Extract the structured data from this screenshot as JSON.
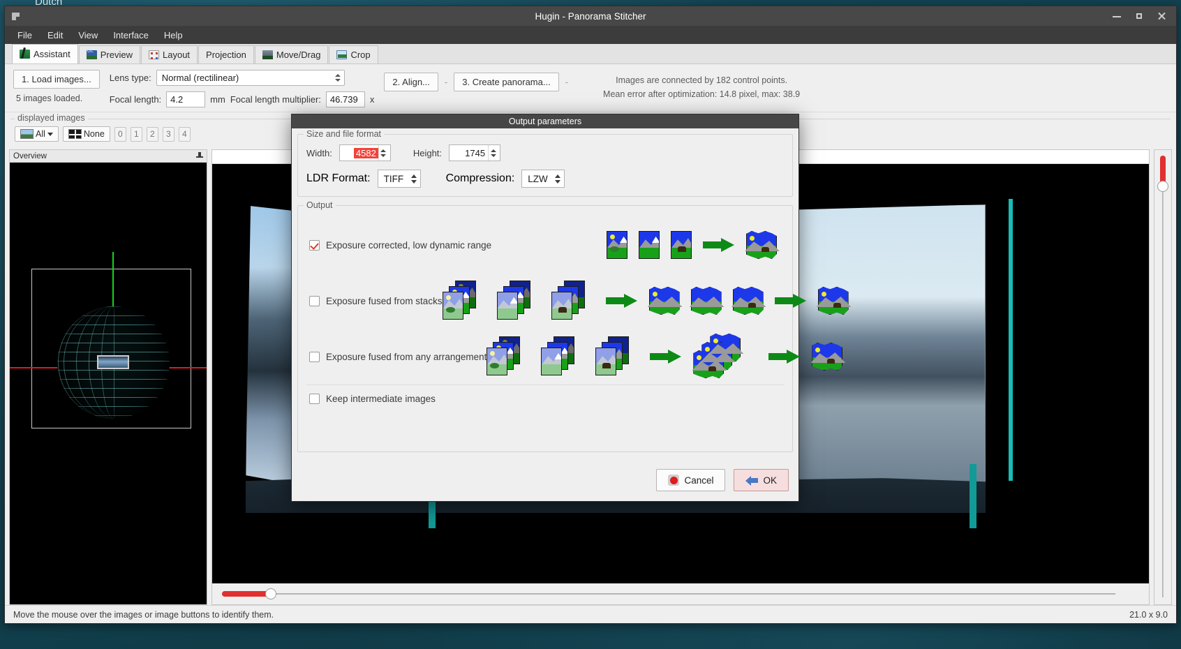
{
  "desktop": {
    "background_text": "Dutch"
  },
  "window": {
    "title": "Hugin - Panorama Stitcher",
    "controls": {
      "minimize": "minimize-button",
      "maximize": "maximize-button",
      "close": "close-button"
    }
  },
  "menubar": {
    "items": [
      "File",
      "Edit",
      "View",
      "Interface",
      "Help"
    ]
  },
  "tabs": [
    {
      "label": "Assistant",
      "icon": "assistant-icon",
      "active": true
    },
    {
      "label": "Preview",
      "icon": "gl-preview-icon",
      "active": false
    },
    {
      "label": "Layout",
      "icon": "layout-icon",
      "active": false
    },
    {
      "label": "Projection",
      "icon": "",
      "active": false
    },
    {
      "label": "Move/Drag",
      "icon": "move-drag-icon",
      "active": false
    },
    {
      "label": "Crop",
      "icon": "crop-icon",
      "active": false
    }
  ],
  "assistant": {
    "load_images_button": "1. Load images...",
    "images_loaded_text": "5 images loaded.",
    "lens_type_label": "Lens type:",
    "lens_type_value": "Normal (rectilinear)",
    "focal_length_label": "Focal length:",
    "focal_length_value": "4.2",
    "focal_length_unit": "mm",
    "focal_multiplier_label": "Focal length multiplier:",
    "focal_multiplier_value": "46.739",
    "focal_multiplier_unit": "x",
    "align_button": "2. Align...",
    "create_panorama_button": "3. Create panorama...",
    "separator": "-",
    "info_line1": "Images are connected by 182 control points.",
    "info_line2": "Mean error after optimization: 14.8 pixel, max: 38.9"
  },
  "displayed_images": {
    "legend": "displayed images",
    "all_button": "All",
    "none_button": "None",
    "number_buttons": [
      "0",
      "1",
      "2",
      "3",
      "4"
    ]
  },
  "overview": {
    "title": "Overview",
    "pin": "pin-icon"
  },
  "statusbar": {
    "message": "Move the mouse over the images or image buttons to identify them.",
    "dimensions": "21.0 x 9.0"
  },
  "dialog": {
    "title": "Output parameters",
    "size_group": {
      "legend": "Size and file format",
      "width_label": "Width:",
      "width_value": "4582",
      "width_selected": true,
      "height_label": "Height:",
      "height_value": "1745",
      "ldr_format_label": "LDR Format:",
      "ldr_format_value": "TIFF",
      "compression_label": "Compression:",
      "compression_value": "LZW"
    },
    "output_group": {
      "legend": "Output",
      "options": [
        {
          "label": "Exposure corrected, low dynamic range",
          "checked": true
        },
        {
          "label": "Exposure fused from stacks",
          "checked": false
        },
        {
          "label": "Exposure fused from any arrangement",
          "checked": false
        }
      ],
      "keep_intermediate_label": "Keep intermediate images",
      "keep_intermediate_checked": false
    },
    "buttons": {
      "cancel": "Cancel",
      "ok": "OK"
    }
  },
  "colors": {
    "accent_red": "#e03030",
    "selection_red": "#f0433a",
    "teal": "#119a96",
    "titlebar": "#484848",
    "green_arrow": "#0d8a16"
  }
}
